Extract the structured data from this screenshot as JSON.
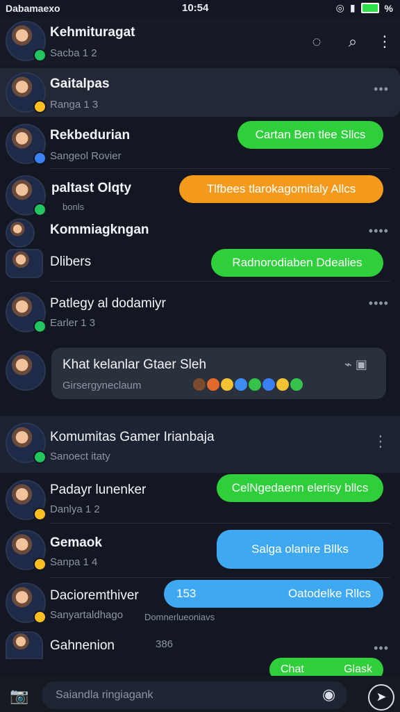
{
  "status": {
    "left": "Dabamaexo",
    "time": "10:54",
    "right": "%"
  },
  "header": {
    "name": "Kehmituragat",
    "sub": "Sacba 1 2"
  },
  "chats": [
    {
      "name": "Gaitalpas",
      "sub": "Ranga 1 3"
    },
    {
      "name": "Rekbedurian",
      "sub": "Sangeol Rovier",
      "bubble": "Cartan Ben tlee Sllcs"
    },
    {
      "name": "paltast Olqty",
      "sub": "bonls",
      "bubble": "Tlfbees tlarokagomitaly Allcs"
    },
    {
      "name": "Kommiagkngan",
      "sub": ""
    },
    {
      "name": "Dlibers",
      "sub": "",
      "bubble": "Radnorodiaben Ddealies"
    },
    {
      "name": "Patlegy al dodamiyr",
      "sub": "Earler 1 3"
    },
    {
      "name": "Khat kelanlar Gtaer Sleh",
      "sub": "Girsergyneclaum"
    },
    {
      "name": "Komumitas Gamer Irianbaja",
      "sub": "Sanoect itaty"
    },
    {
      "name": "Padayr lunenker",
      "sub": "Danlya 1 2",
      "bubble": "CelNgedaenn elerisy bllcs"
    },
    {
      "name": "Gemaok",
      "sub": "Sanpa 1 4",
      "bubble": "Salga olanire Bllks"
    },
    {
      "name": "Dacioremthiver",
      "sub": "Sanyartaldhago",
      "bubble": "Oatodelke Rllcs",
      "count": "153",
      "extra": "Domnerlueoniavs"
    },
    {
      "name": "Gahnenion",
      "sub": "",
      "count": "386"
    }
  ],
  "bottom_bubble": "Chat",
  "bottom_bubble2": "Glask",
  "input": {
    "placeholder": "Saiandla ringiagank"
  },
  "icons": [
    "camera-icon",
    "search-icon",
    "more-icon",
    "compass-icon",
    "send-icon"
  ]
}
